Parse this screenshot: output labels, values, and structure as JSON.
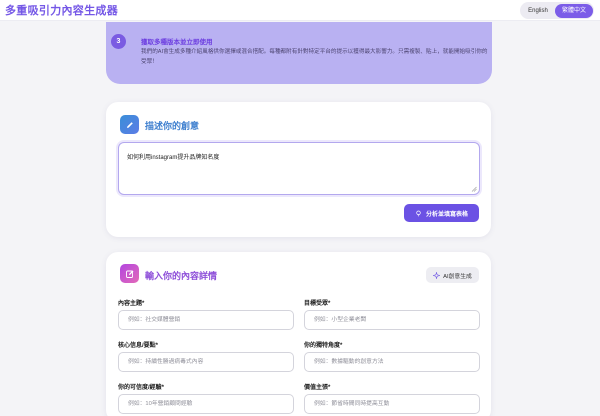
{
  "header": {
    "app_title": "多重吸引力內容生成器",
    "lang_en": "English",
    "lang_zh": "繁體中文"
  },
  "step": {
    "number": "3",
    "title": "獲取多種版本並立即使用",
    "desc": "我們的AI會生成多種介紹風格供你選擇或混合搭配。每種都附有針對特定平台的提示以獲得最大影響力。只需複製、貼上，就能開始吸引你的受眾！"
  },
  "idea_card": {
    "title": "描述你的創意",
    "text": "如何利用instagram提升品牌知名度",
    "analyze_button": "分析並填寫表格"
  },
  "details_card": {
    "title": "輸入你的內容詳情",
    "ai_button": "AI創意生成",
    "fields": [
      {
        "label": "內容主題*",
        "placeholder": "例如：社交媒體營銷"
      },
      {
        "label": "目標受眾*",
        "placeholder": "例如：小型企業老闆"
      },
      {
        "label": "核心信息/要點*",
        "placeholder": "例如：持續性勝過病毒式內容"
      },
      {
        "label": "你的獨特角度*",
        "placeholder": "例如：數據驅動的創意方法"
      },
      {
        "label": "你的可信度/經驗*",
        "placeholder": "例如：10年營銷顧問經驗"
      },
      {
        "label": "價值主張*",
        "placeholder": "例如：節省時間同時提高互動"
      }
    ]
  },
  "colors": {
    "accent": "#6b52e4",
    "banner": "#b9b1f2",
    "title_blue": "#3e7fcf",
    "title_purple": "#8d4ed9"
  },
  "icons": {
    "idea_card": "pencil-icon",
    "details_card": "edit-icon",
    "analyze_button": "lightbulb-icon",
    "ai_button": "sparkle-icon"
  }
}
